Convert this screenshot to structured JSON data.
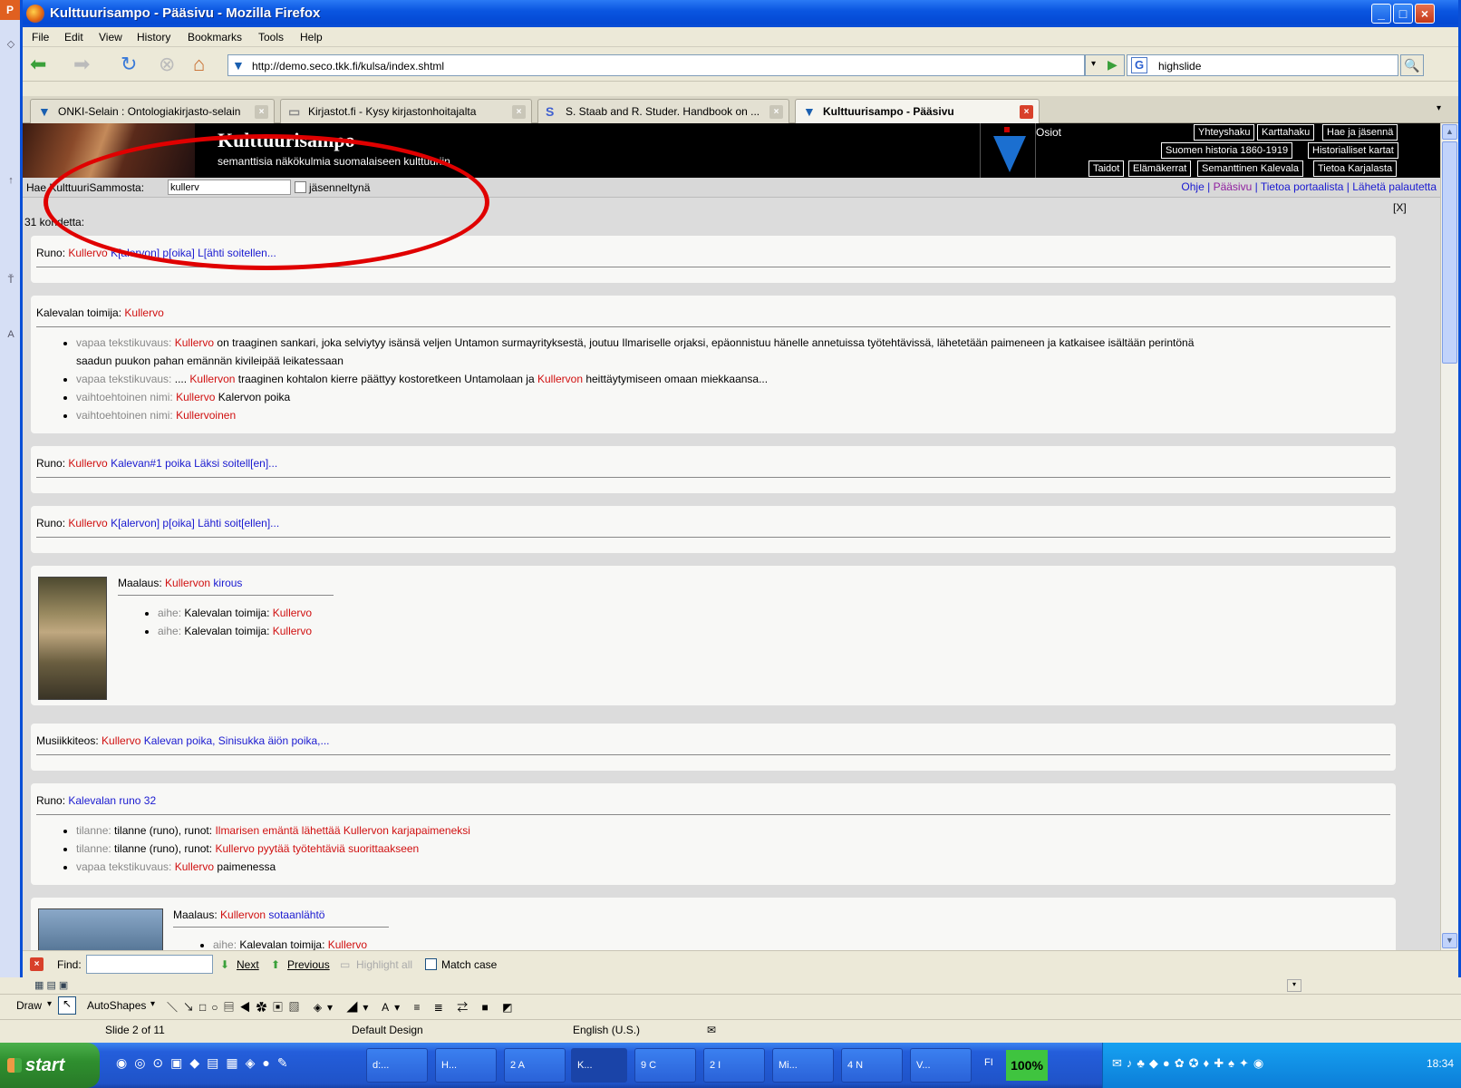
{
  "window": {
    "title": "Kulttuurisampo - Pääsivu - Mozilla Firefox"
  },
  "menu": [
    "File",
    "Edit",
    "View",
    "History",
    "Bookmarks",
    "Tools",
    "Help"
  ],
  "nav": {
    "url": "http://demo.seco.tkk.fi/kulsa/index.shtml",
    "search_value": "highslide"
  },
  "tabs": [
    {
      "label": "ONKI-Selain : Ontologiakirjasto-selain"
    },
    {
      "label": "Kirjastot.fi - Kysy kirjastonhoitajalta"
    },
    {
      "label": "S. Staab and R. Studer. Handbook on ..."
    },
    {
      "label": "Kulttuurisampo - Pääsivu"
    }
  ],
  "site": {
    "title": "Kulttuurisampo",
    "subtitle": "semanttisia näkökulmia suomalaiseen kulttuuriin",
    "osiot": "Osiot",
    "header_links_row1": [
      "Yhteyshaku",
      "Karttahaku",
      "Hae ja jäsennä"
    ],
    "header_links_row2": [
      "Suomen historia 1860-1919",
      "Historialliset kartat"
    ],
    "header_links_row3": [
      "Taidot",
      "Elämäkerrat",
      "Semanttinen Kalevala",
      "Tietoa Karjalasta"
    ],
    "search_label": "Hae KulttuuriSammosta:",
    "search_value": "kullerv",
    "checkbox_label": "jäsenneltynä",
    "links": [
      "Ohje",
      "Pääsivu",
      "Tietoa portaalista",
      "Lähetä palautetta"
    ],
    "count": "31 kohdetta:",
    "close": "[X]"
  },
  "results": [
    {
      "type": "Runo:",
      "parts": [
        [
          "red",
          "Kullervo"
        ],
        [
          "blue",
          " K[alervon] p[oika] L[ähti soitellen..."
        ]
      ]
    },
    {
      "type": "Kalevalan toimija:",
      "parts": [
        [
          "red",
          "Kullervo"
        ]
      ],
      "items": [
        [
          [
            "gray",
            "vapaa tekstikuvaus: "
          ],
          [
            "red",
            "Kullervo"
          ],
          [
            "",
            " on traaginen sankari, joka selviytyy isänsä veljen Untamon surmayrityksestä, joutuu Ilmariselle orjaksi, epäonnistuu hänelle annetuissa työtehtävissä, lähetetään paimeneen ja katkaisee isältään perintönä"
          ]
        ],
        [
          [
            "",
            "saadun puukon pahan emännän kivileipää leikatessaan"
          ]
        ],
        [
          [
            "gray",
            "vapaa tekstikuvaus: "
          ],
          [
            "",
            ".... "
          ],
          [
            "red",
            "Kullervon"
          ],
          [
            "",
            " traaginen kohtalon kierre päättyy kostoretkeen Untamolaan ja "
          ],
          [
            "red",
            "Kullervon"
          ],
          [
            "",
            " heittäytymiseen omaan miekkaansa..."
          ]
        ],
        [
          [
            "gray",
            "vaihtoehtoinen nimi: "
          ],
          [
            "red",
            "Kullervo"
          ],
          [
            "",
            " Kalervon poika"
          ]
        ],
        [
          [
            "gray",
            "vaihtoehtoinen nimi: "
          ],
          [
            "red",
            "Kullervoinen"
          ]
        ]
      ]
    },
    {
      "type": "Runo:",
      "parts": [
        [
          "red",
          "Kullervo"
        ],
        [
          "blue",
          " Kalevan#1 poika Läksi soitell[en]..."
        ]
      ]
    },
    {
      "type": "Runo:",
      "parts": [
        [
          "red",
          "Kullervo"
        ],
        [
          "blue",
          " K[alervon] p[oika] Lähti soit[ellen]..."
        ]
      ]
    },
    {
      "type": "Maalaus:",
      "parts": [
        [
          "red",
          "Kullervon"
        ],
        [
          "blue",
          " kirous"
        ]
      ],
      "items": [
        [
          [
            "gray",
            "aihe: "
          ],
          [
            "",
            "Kalevalan toimija: "
          ],
          [
            "red",
            "Kullervo"
          ]
        ],
        [
          [
            "gray",
            "aihe: "
          ],
          [
            "",
            "Kalevalan toimija: "
          ],
          [
            "red",
            "Kullervo"
          ]
        ]
      ]
    },
    {
      "type": "Musiikkiteos:",
      "parts": [
        [
          "red",
          "Kullervo"
        ],
        [
          "blue",
          " Kalevan poika, Sinisukka äiön poika,..."
        ]
      ]
    },
    {
      "type": "Runo:",
      "parts": [
        [
          "blue",
          "Kalevalan runo 32"
        ]
      ],
      "items": [
        [
          [
            "gray",
            "tilanne: "
          ],
          [
            "",
            "tilanne (runo), runot: "
          ],
          [
            "red",
            "Ilmarisen emäntä lähettää Kullervon karjapaimeneksi"
          ]
        ],
        [
          [
            "gray",
            "tilanne: "
          ],
          [
            "",
            "tilanne (runo), runot: "
          ],
          [
            "red",
            "Kullervo pyytää työtehtäviä suorittaakseen"
          ]
        ],
        [
          [
            "gray",
            "vapaa tekstikuvaus: "
          ],
          [
            "red",
            "Kullervo"
          ],
          [
            "",
            " paimenessa"
          ]
        ]
      ]
    },
    {
      "type": "Maalaus:",
      "parts": [
        [
          "red",
          "Kullervon"
        ],
        [
          "blue",
          " sotaanlähtö"
        ]
      ],
      "items": [
        [
          [
            "gray",
            "aihe: "
          ],
          [
            "",
            "Kalevalan toimija: "
          ],
          [
            "red",
            "Kullervo"
          ]
        ]
      ]
    }
  ],
  "findbar": {
    "label": "Find:",
    "next": "Next",
    "previous": "Previous",
    "highlight": "Highlight all",
    "match": "Match case"
  },
  "ppt": {
    "draw": "Draw",
    "autoshapes": "AutoShapes",
    "slide": "Slide 2 of 11",
    "design": "Default Design",
    "lang": "English (U.S.)"
  },
  "taskbar": {
    "start": "start",
    "items": [
      "d:...",
      "H...",
      "2 A",
      "K...",
      "9 C",
      "2 I",
      "Mi...",
      "4 N",
      "V..."
    ],
    "lang": "FI",
    "zoom": "100%",
    "clock": "18:34"
  },
  "colors": {
    "accent": "#d01010",
    "link": "#1a1ad0",
    "annotation": "#e00000"
  }
}
